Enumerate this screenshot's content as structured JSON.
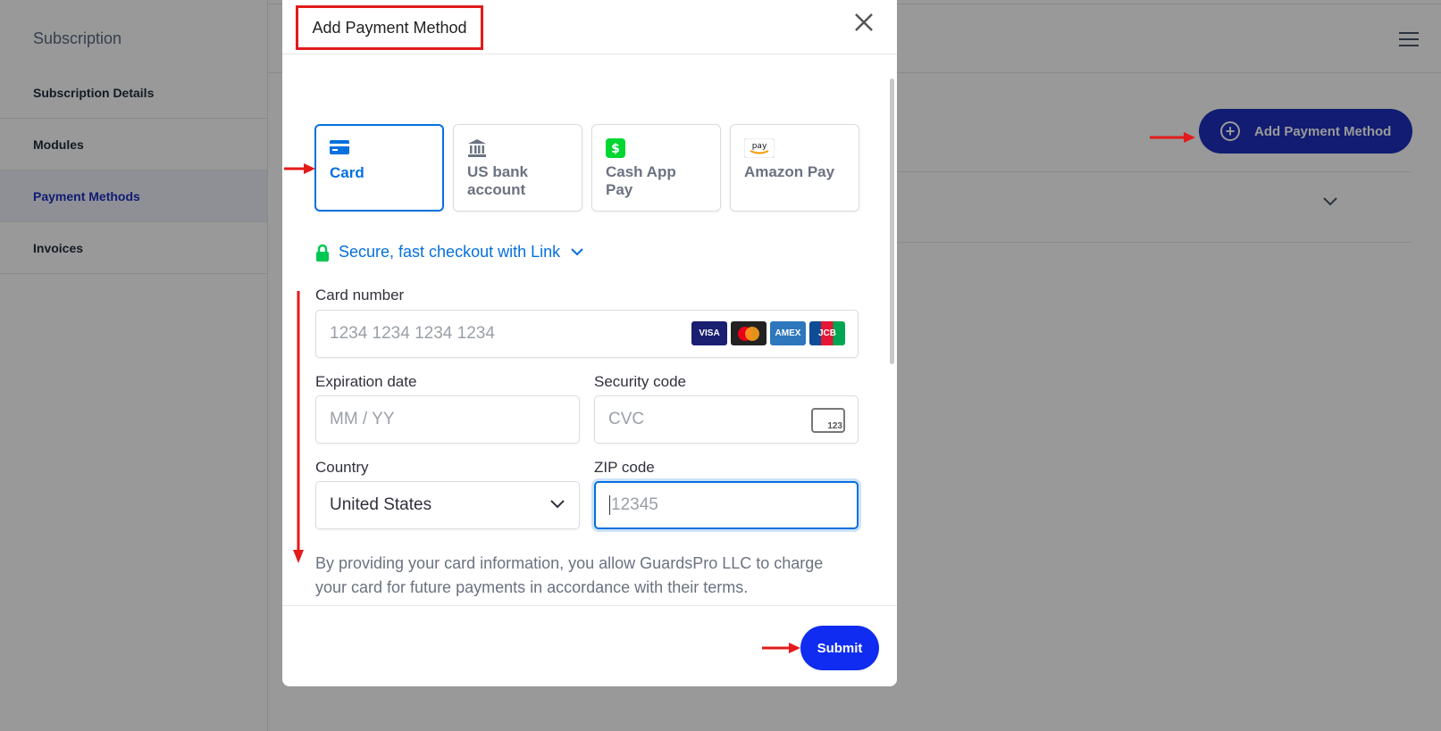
{
  "sidebar": {
    "title": "Subscription",
    "items": [
      {
        "label": "Subscription Details"
      },
      {
        "label": "Modules"
      },
      {
        "label": "Payment Methods"
      },
      {
        "label": "Invoices"
      }
    ]
  },
  "background": {
    "add_button_label": "Add Payment Method"
  },
  "modal": {
    "title": "Add Payment Method",
    "tabs": [
      {
        "label": "Card",
        "icon": "card-icon"
      },
      {
        "label": "US bank account",
        "icon": "bank-icon"
      },
      {
        "label": "Cash App Pay",
        "icon": "cash-app-icon"
      },
      {
        "label": "Amazon Pay",
        "icon": "amazon-pay-icon"
      }
    ],
    "link_text": "Secure, fast checkout with Link",
    "card_number": {
      "label": "Card number",
      "placeholder": "1234 1234 1234 1234",
      "brands": [
        "VISA",
        "MC",
        "AMEX",
        "JCB"
      ]
    },
    "expiration": {
      "label": "Expiration date",
      "placeholder": "MM / YY"
    },
    "security": {
      "label": "Security code",
      "placeholder": "CVC",
      "icon_text": "123"
    },
    "country": {
      "label": "Country",
      "value": "United States"
    },
    "zip": {
      "label": "ZIP code",
      "placeholder": "12345"
    },
    "disclaimer": "By providing your card information, you allow GuardsPro LLC to charge your card for future payments in accordance with their terms.",
    "submit_label": "Submit"
  },
  "colors": {
    "accent": "#0570de",
    "primary_button": "#0f2cf0",
    "annotation": "#e31b1b"
  }
}
